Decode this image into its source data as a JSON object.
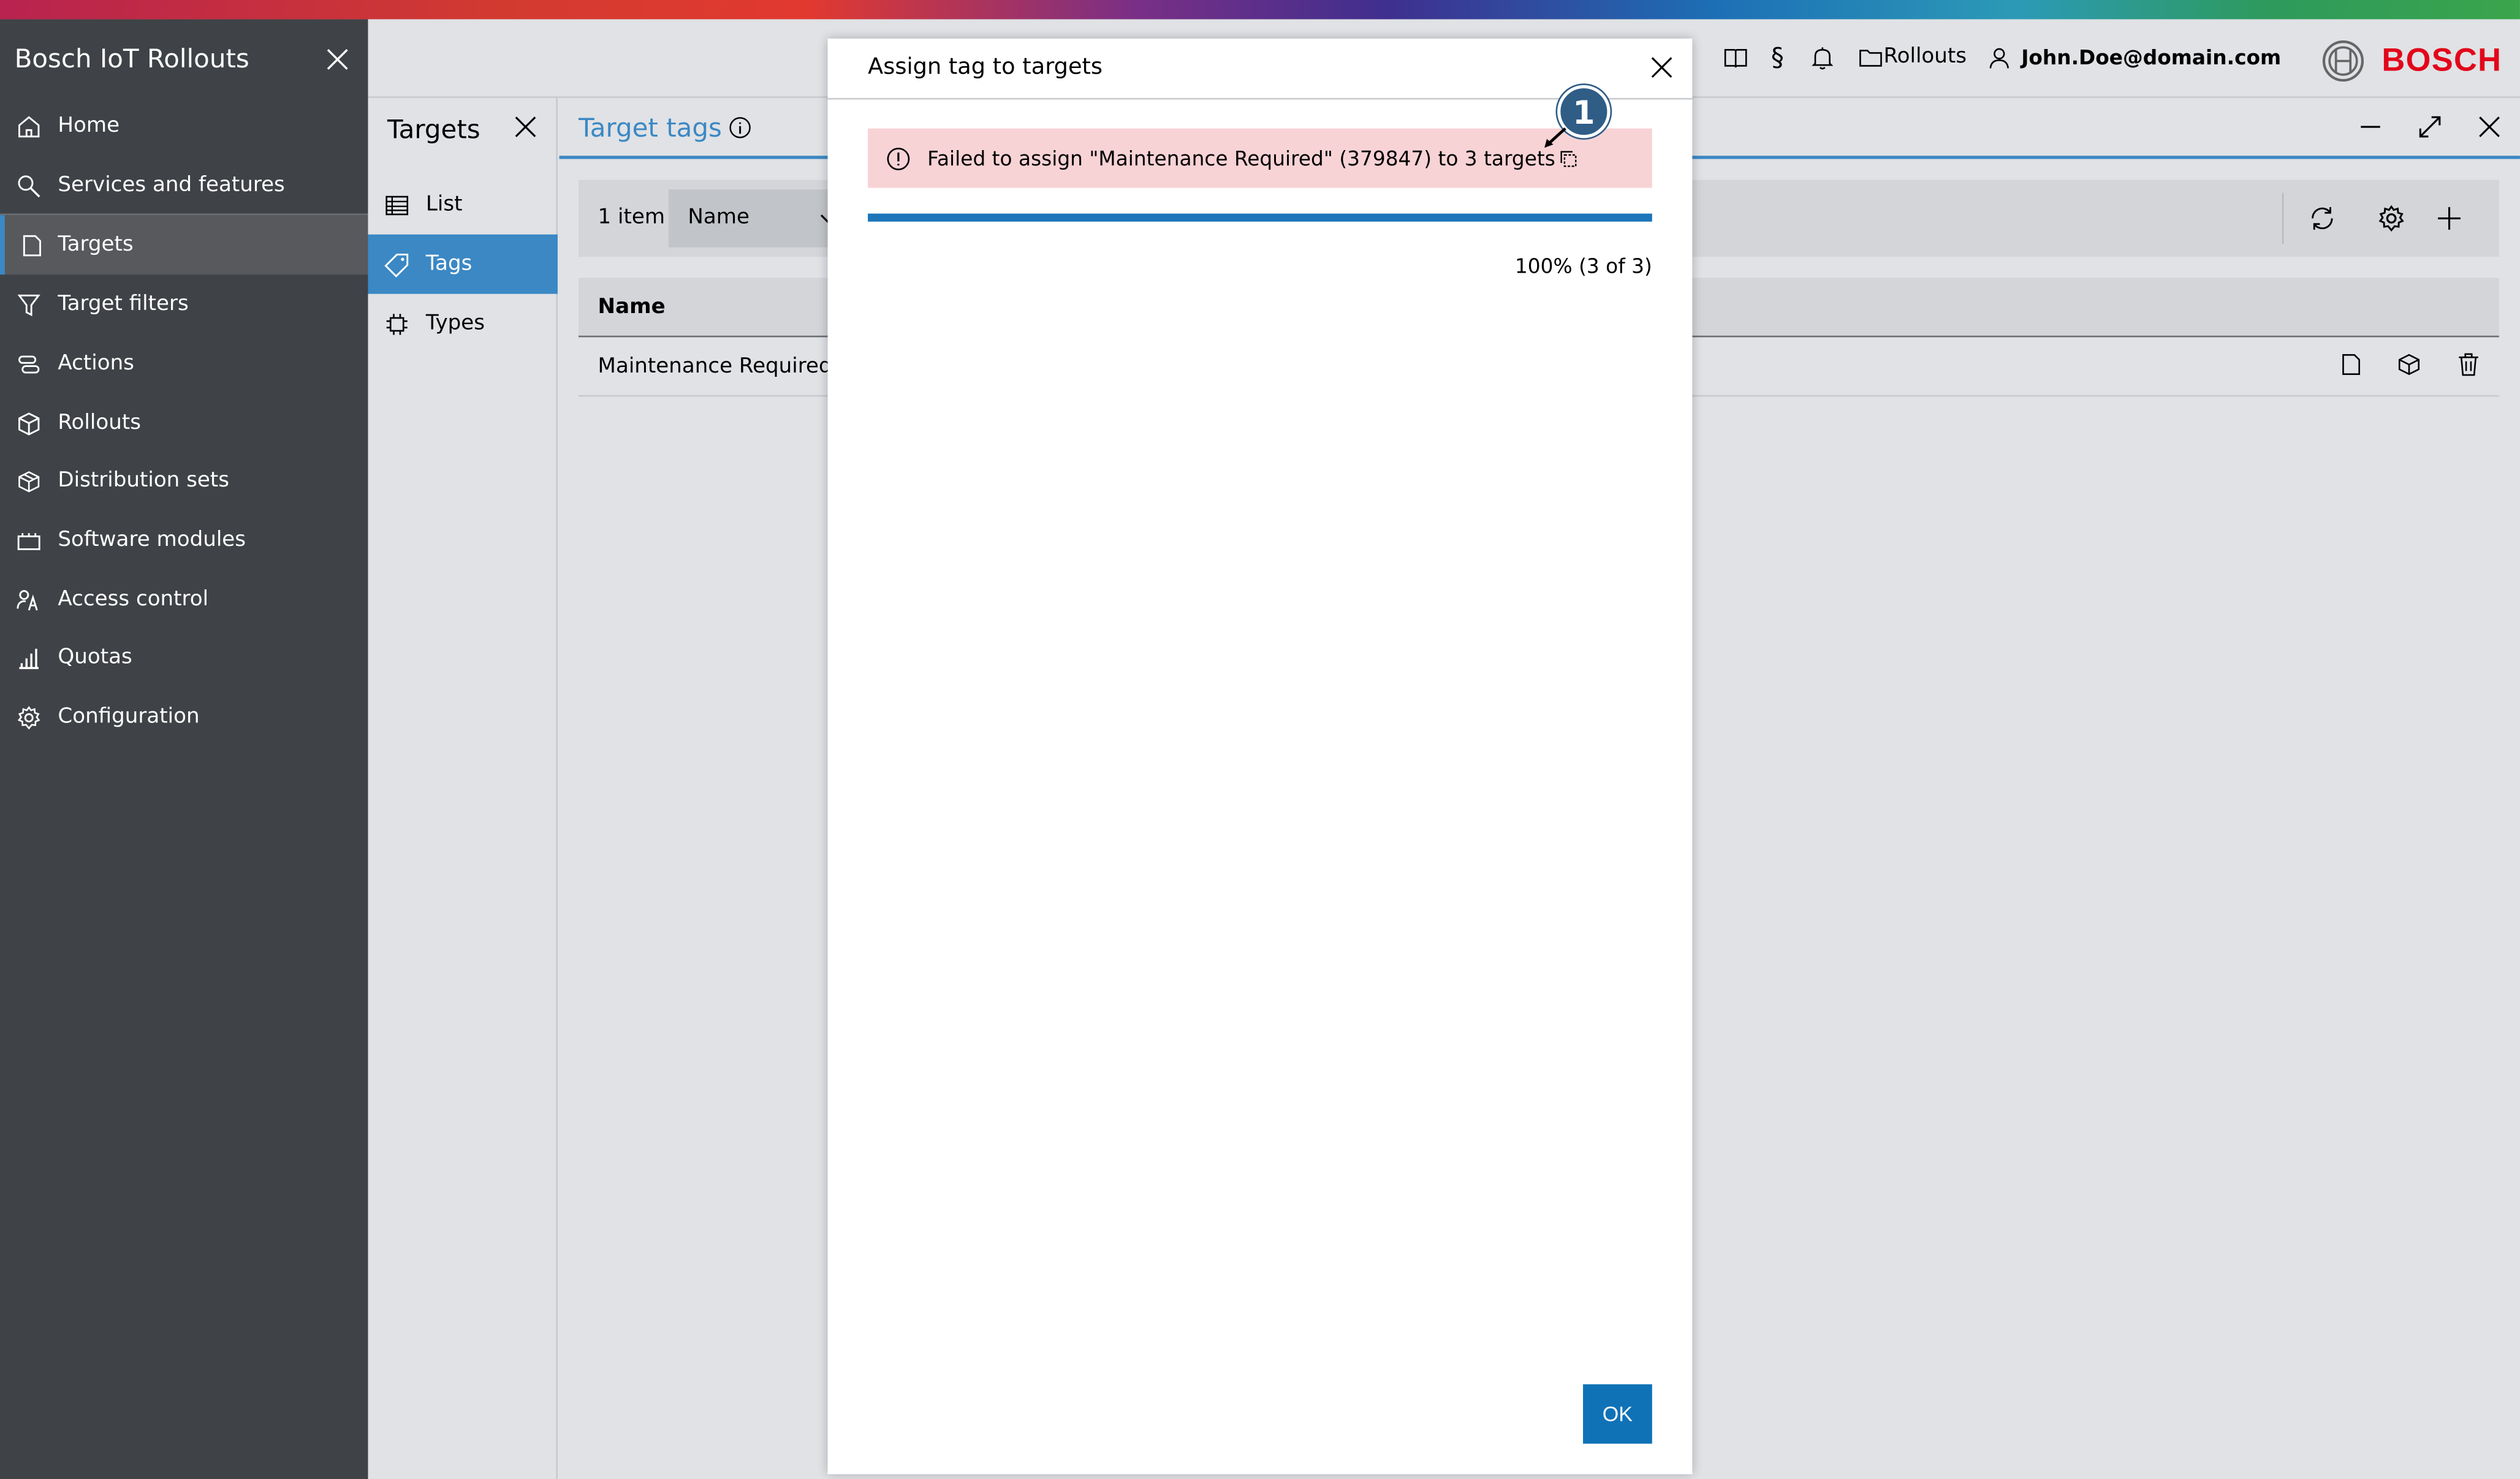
{
  "sidebar": {
    "title": "Bosch IoT Rollouts",
    "items": [
      {
        "label": "Home",
        "icon": "home-icon"
      },
      {
        "label": "Services and features",
        "icon": "search-icon"
      },
      {
        "label": "Targets",
        "icon": "targets-icon",
        "active": true
      },
      {
        "label": "Target filters",
        "icon": "filter-icon"
      },
      {
        "label": "Actions",
        "icon": "actions-icon"
      },
      {
        "label": "Rollouts",
        "icon": "rollouts-icon"
      },
      {
        "label": "Distribution sets",
        "icon": "distribution-icon"
      },
      {
        "label": "Software modules",
        "icon": "modules-icon"
      },
      {
        "label": "Access control",
        "icon": "access-icon"
      },
      {
        "label": "Quotas",
        "icon": "quotas-icon"
      },
      {
        "label": "Configuration",
        "icon": "gear-icon"
      }
    ]
  },
  "header": {
    "section_label": "Rollouts",
    "user": "John.Doe@domain.com",
    "brand": "BOSCH"
  },
  "subnav": {
    "title": "Targets",
    "items": [
      {
        "label": "List",
        "icon": "list-icon"
      },
      {
        "label": "Tags",
        "icon": "tag-icon",
        "active": true
      },
      {
        "label": "Types",
        "icon": "chip-icon"
      }
    ]
  },
  "main": {
    "title": "Target tags",
    "count": "1 item",
    "sort_select": "Name",
    "columns": [
      "Name"
    ],
    "rows": [
      {
        "name": "Maintenance Required"
      }
    ]
  },
  "modal": {
    "title": "Assign tag to targets",
    "alert_text": "Failed to assign \"Maintenance Required\" (379847) to 3 targets",
    "progress_percent": 100,
    "progress_text": "100% (3 of 3)",
    "ok_label": "OK"
  },
  "callout": {
    "number": "1"
  },
  "colors": {
    "accent": "#3b88c4",
    "primary_button": "#0f72b7",
    "alert_bg": "#f8d3d6",
    "brand_red": "#e2061a",
    "sidebar_bg": "#3f4246"
  }
}
